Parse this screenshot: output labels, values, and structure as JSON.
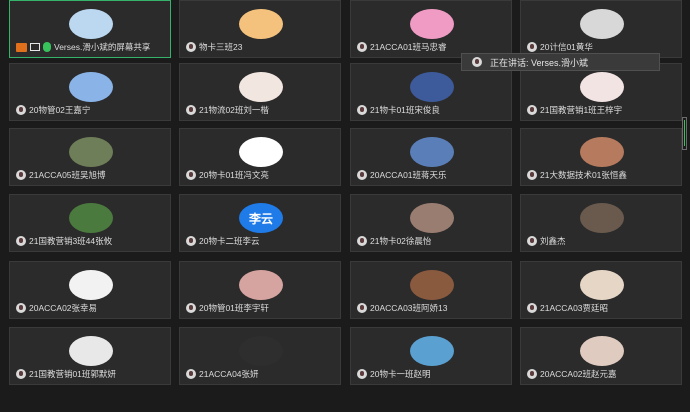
{
  "speaker_popup": "正在讲话: Verses.滑小斌",
  "colors": {
    "active_border": "#35b36a",
    "share_badge": "#e0701b",
    "mic_active": "#38c25c"
  },
  "participants": [
    {
      "name": "Verses.滑小斌的屏幕共享",
      "avatar": "snow-photo",
      "avatar_color": "#bcd8f0",
      "sharing": true
    },
    {
      "name": "物卡三班23",
      "avatar": "dog-photo",
      "avatar_color": "#f4c27c"
    },
    {
      "name": "21ACCA01班马忠睿",
      "avatar": "pink-cat-photo",
      "avatar_color": "#f09bc3"
    },
    {
      "name": "20计信01黄华",
      "avatar": "girl-photo",
      "avatar_color": "#d8d8d8"
    },
    {
      "name": "20物管02王嘉宁",
      "avatar": "kid-photo",
      "avatar_color": "#8ab4e8"
    },
    {
      "name": "21物流02班刘一楷",
      "avatar": "drawing",
      "avatar_color": "#f2e6e0"
    },
    {
      "name": "21物卡01班宋俊良",
      "avatar": "team-photo",
      "avatar_color": "#3d5a9a"
    },
    {
      "name": "21国教营销1班王梓宇",
      "avatar": "cartoon",
      "avatar_color": "#f3e4e4"
    },
    {
      "name": "21ACCA05班吴旭博",
      "avatar": "bear-photo",
      "avatar_color": "#6e7e58"
    },
    {
      "name": "20物卡01班冯文亮",
      "avatar": "panda",
      "avatar_color": "#ffffff"
    },
    {
      "name": "20ACCA01班蒋天乐",
      "avatar": "sky-photo",
      "avatar_color": "#5a7fb8"
    },
    {
      "name": "21大数据技术01张恒鑫",
      "avatar": "sunset-photo",
      "avatar_color": "#b67a5e"
    },
    {
      "name": "21国教营销3班44张攸",
      "avatar": "forest-photo",
      "avatar_color": "#4b7a3f"
    },
    {
      "name": "20物卡二班李云",
      "avatar": "text",
      "avatar_text": "李云",
      "avatar_color": "#1f7be8"
    },
    {
      "name": "21物卡02徐晨怡",
      "avatar": "portrait",
      "avatar_color": "#9a7d71"
    },
    {
      "name": "刘鑫杰",
      "avatar": "person-photo",
      "avatar_color": "#6a5a4e"
    },
    {
      "name": "20ACCA02张幸易",
      "avatar": "pig-cartoon",
      "avatar_color": "#f2f2f2"
    },
    {
      "name": "20物管01班李宇轩",
      "avatar": "pink-photo",
      "avatar_color": "#d6a4a0"
    },
    {
      "name": "20ACCA03班阿娇13",
      "avatar": "group-photo",
      "avatar_color": "#8a5a3e"
    },
    {
      "name": "21ACCA03贾廷昭",
      "avatar": "girl2-photo",
      "avatar_color": "#e6d6c6"
    },
    {
      "name": "21国教营销01班郭默妍",
      "avatar": "girl3-photo",
      "avatar_color": "#e8e8e8"
    },
    {
      "name": "21ACCA04张妍",
      "avatar": "dark-photo",
      "avatar_color": "#2e2e2e"
    },
    {
      "name": "20物卡一班赵明",
      "avatar": "beach-photo",
      "avatar_color": "#5aa0d0"
    },
    {
      "name": "20ACCA02班赵元嘉",
      "avatar": "girl4-photo",
      "avatar_color": "#e0cbc0"
    }
  ]
}
